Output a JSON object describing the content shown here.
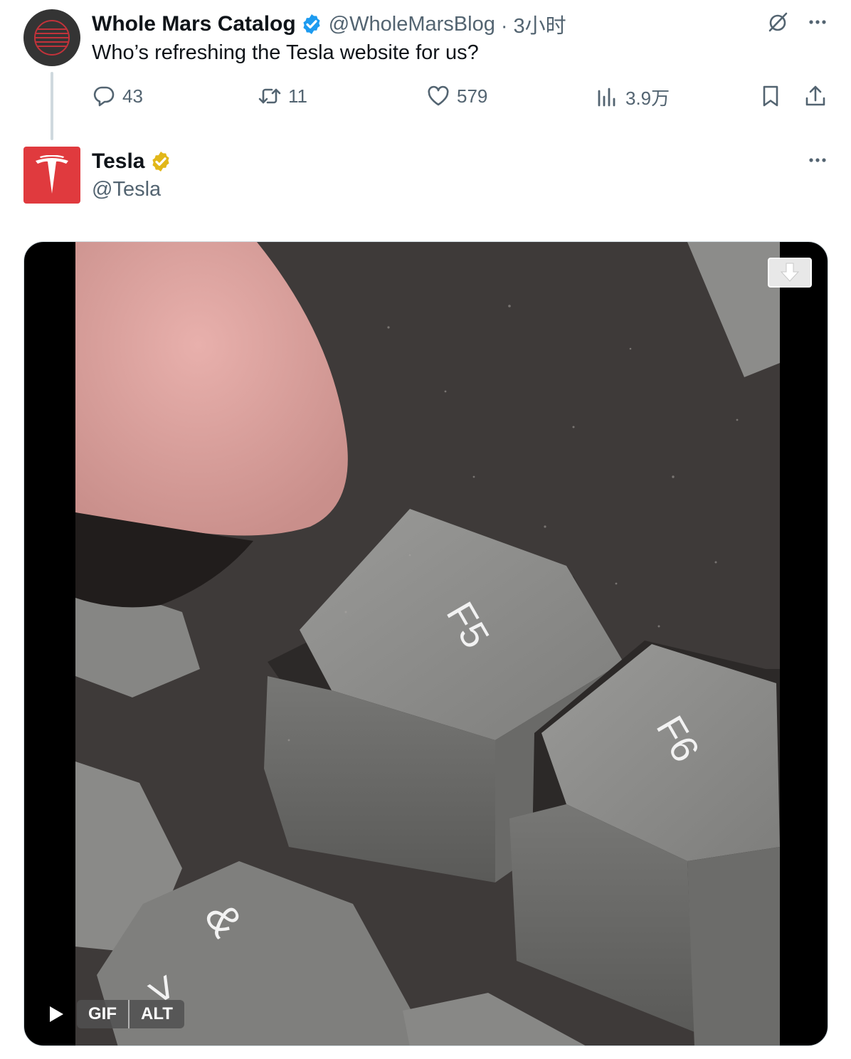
{
  "original_tweet": {
    "display_name": "Whole Mars Catalog",
    "handle": "@WholeMarsBlog",
    "time": "· 3小时",
    "text": "Who’s refreshing the Tesla website for us?",
    "stats": {
      "replies": "43",
      "reposts": "11",
      "likes": "579",
      "views": "3.9万"
    }
  },
  "reply_tweet": {
    "display_name": "Tesla",
    "handle": "@Tesla",
    "media": {
      "type": "gif",
      "gif_label": "GIF",
      "alt_label": "ALT",
      "key_labels": [
        "F5",
        "F6",
        "&",
        ">"
      ]
    }
  },
  "colors": {
    "verified_blue": "#1d9bf0",
    "verified_gold": "#e2b719",
    "tesla_red": "#e03a3e",
    "muted_text": "#536471"
  },
  "icons": [
    "grok-icon",
    "more-icon",
    "reply-icon",
    "repost-icon",
    "like-icon",
    "views-icon",
    "bookmark-icon",
    "share-icon",
    "play-icon",
    "download-icon",
    "tesla-logo-icon"
  ]
}
